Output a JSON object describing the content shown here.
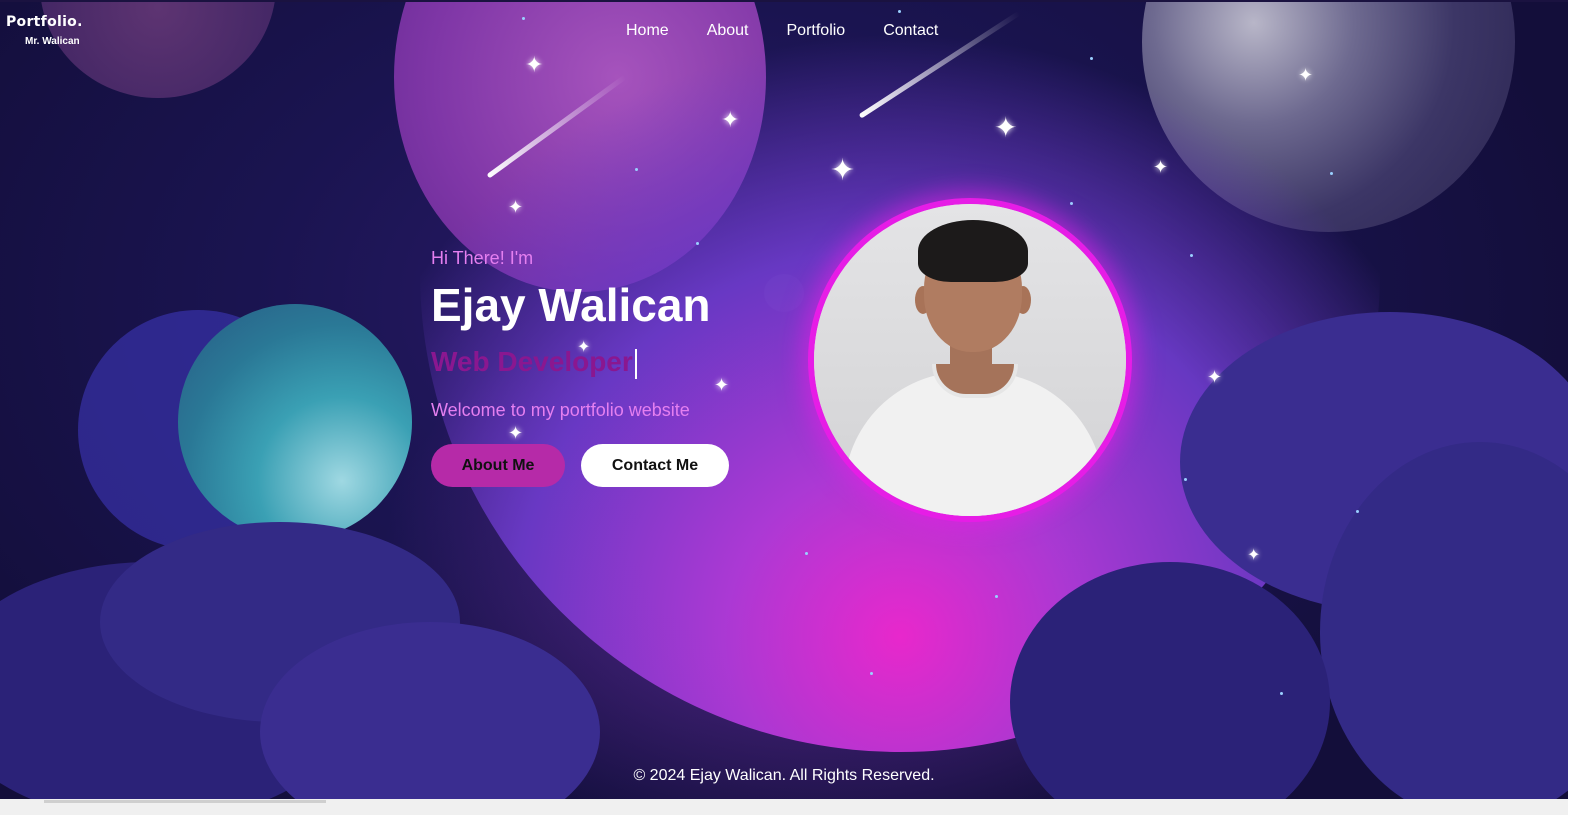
{
  "logo": {
    "title": "Portfolio.",
    "subtitle": "Mr. Walican"
  },
  "nav": {
    "items": [
      "Home",
      "About",
      "Portfolio",
      "Contact"
    ]
  },
  "hero": {
    "greeting": "Hi There! I'm",
    "name": "Ejay Walican",
    "role": "Web Developer",
    "welcome": "Welcome to my portfolio website",
    "about_button": "About Me",
    "contact_button": "Contact Me"
  },
  "profile_photo": {
    "icon": "profile-photo"
  },
  "footer": {
    "copyright": "© 2024 Ejay Walican. All Rights Reserved."
  },
  "colors": {
    "accent_pink": "#e57ff0",
    "role_purple": "#8a1790",
    "button_magenta": "#b62aa8",
    "ring_magenta": "#e61de6"
  }
}
